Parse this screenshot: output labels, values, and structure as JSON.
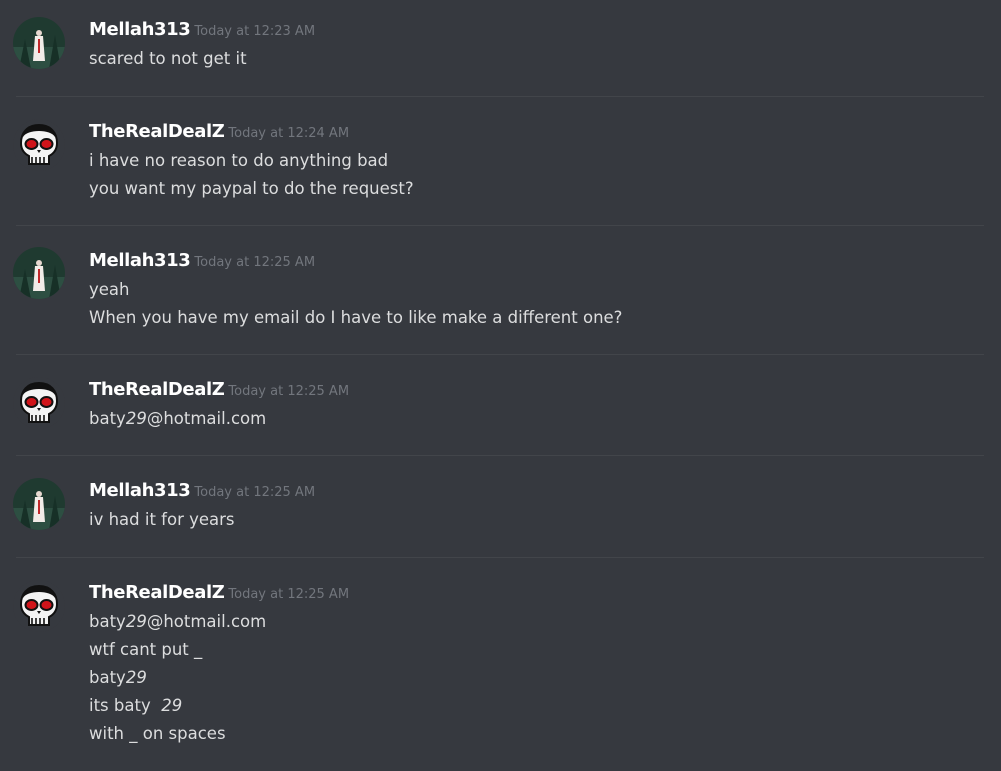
{
  "messages": [
    {
      "author": "Mellah313",
      "timestamp": "Today at 12:23 AM",
      "avatar": "forest-figure-avatar",
      "lines": [
        "scared to not get it"
      ]
    },
    {
      "author": "TheRealDealZ",
      "timestamp": "Today at 12:24 AM",
      "avatar": "skull-avatar",
      "lines": [
        "i have no reason to do anything bad",
        "you want my paypal to do the request?"
      ]
    },
    {
      "author": "Mellah313",
      "timestamp": "Today at 12:25 AM",
      "avatar": "forest-figure-avatar",
      "lines": [
        "yeah",
        "When you have my email do I have to like make a different one?"
      ]
    },
    {
      "author": "TheRealDealZ",
      "timestamp": "Today at 12:25 AM",
      "avatar": "skull-avatar",
      "lines": [
        {
          "before": "baty",
          "italic": "29",
          "after": "@hotmail.com"
        }
      ]
    },
    {
      "author": "Mellah313",
      "timestamp": "Today at 12:25 AM",
      "avatar": "forest-figure-avatar",
      "lines": [
        "iv had it for years"
      ]
    },
    {
      "author": "TheRealDealZ",
      "timestamp": "Today at 12:25 AM",
      "avatar": "skull-avatar",
      "lines": [
        {
          "before": "baty",
          "italic": "29",
          "after": "@hotmail.com"
        },
        "wtf cant put _",
        {
          "before": "baty",
          "italic": "29",
          "after": ""
        },
        {
          "before": "its baty  ",
          "italic": "29",
          "after": ""
        },
        "with _ on spaces"
      ]
    }
  ]
}
